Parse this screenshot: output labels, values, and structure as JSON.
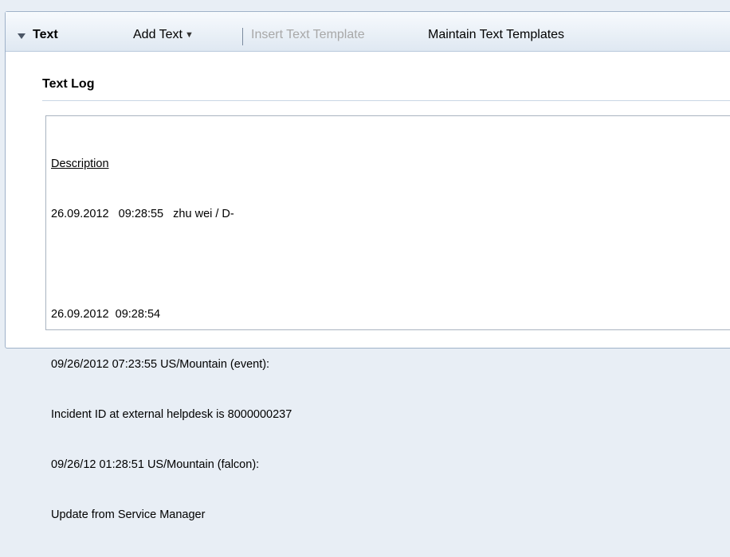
{
  "toolbar": {
    "title": "Text",
    "add_text_label": "Add Text",
    "insert_template_label": "Insert Text Template",
    "maintain_templates_label": "Maintain Text Templates"
  },
  "section": {
    "title": "Text Log"
  },
  "log": {
    "heading": "Description",
    "lines": [
      "26.09.2012   09:28:55   zhu wei / D-",
      "",
      "26.09.2012  09:28:54",
      "09/26/2012 07:23:55 US/Mountain (event):",
      "Incident ID at external helpdesk is 8000000237",
      "09/26/12 01:28:51 US/Mountain (falcon):",
      "Update from Service Manager"
    ]
  },
  "colors": {
    "background": "#e8eef5",
    "panel_border": "#9fb2c9",
    "disabled_text": "#a8a8a8"
  },
  "icons": {
    "collapse": "triangle-down-icon",
    "dropdown": "dropdown-arrow-icon"
  }
}
